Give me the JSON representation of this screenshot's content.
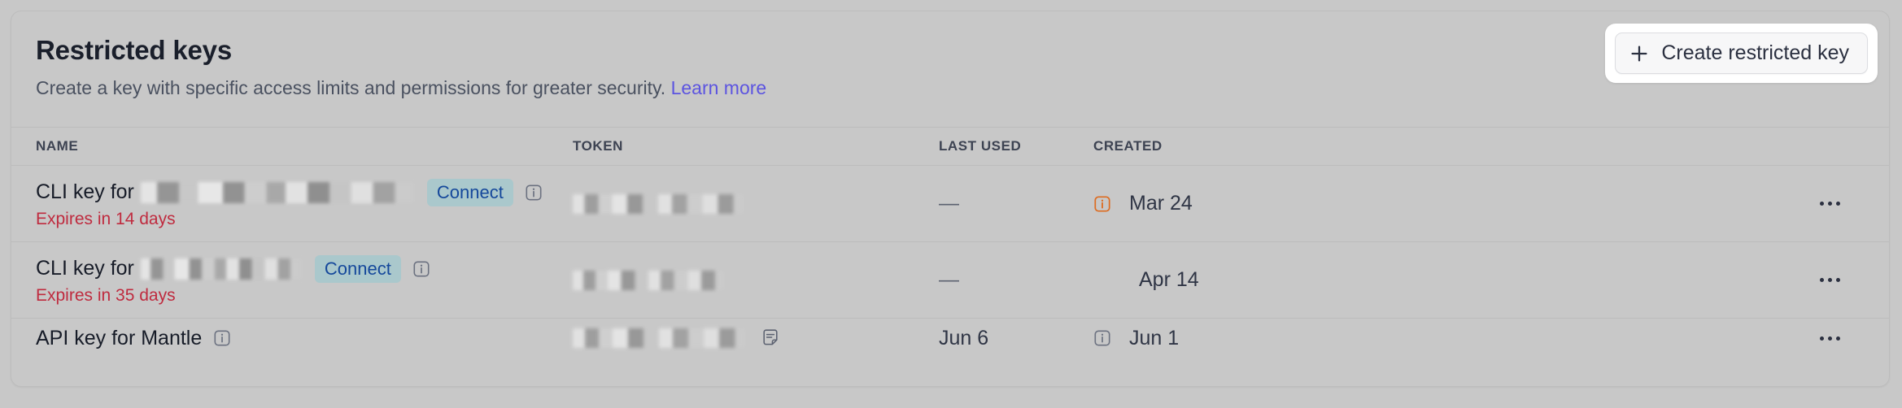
{
  "card": {
    "title": "Restricted keys",
    "subtitle": "Create a key with specific access limits and permissions for greater security.",
    "learn_more_label": "Learn more",
    "create_button_label": "Create restricted key",
    "plus_icon": "plus-icon"
  },
  "table": {
    "columns": [
      "NAME",
      "TOKEN",
      "LAST USED",
      "CREATED"
    ],
    "rows": [
      {
        "name_prefix": "CLI key for",
        "name_redacted": true,
        "badge": "Connect",
        "has_name_info": true,
        "expires": "Expires in 14 days",
        "token_redacted": true,
        "has_token_copy": false,
        "last_used": "—",
        "created": "Mar 24",
        "created_info_icon": "orange",
        "menu": "overflow-menu"
      },
      {
        "name_prefix": "CLI key for",
        "name_redacted": true,
        "badge": "Connect",
        "has_name_info": true,
        "expires": "Expires in 35 days",
        "token_redacted": true,
        "has_token_copy": false,
        "last_used": "—",
        "created": "Apr 14",
        "created_info_icon": "none",
        "menu": "overflow-menu"
      },
      {
        "name_prefix": "API key for Mantle",
        "name_redacted": false,
        "badge": "",
        "has_name_info": true,
        "expires": "",
        "token_redacted": true,
        "has_token_copy": true,
        "last_used": "Jun 6",
        "created": "Jun 1",
        "created_info_icon": "gray",
        "menu": "overflow-menu"
      }
    ]
  },
  "colors": {
    "page_background": "#c8c8c8",
    "title_text": "#1a1f2b",
    "subtitle_text": "#4a5160",
    "link": "#5c54e0",
    "expires_warning": "#bf2b3f",
    "badge_background": "#aac8cc",
    "badge_text": "#15489b",
    "info_icon_orange": "#dd6b20",
    "info_icon_gray": "#6b7180",
    "divider": "#bcbcbc",
    "button_surface": "#ffffff"
  }
}
